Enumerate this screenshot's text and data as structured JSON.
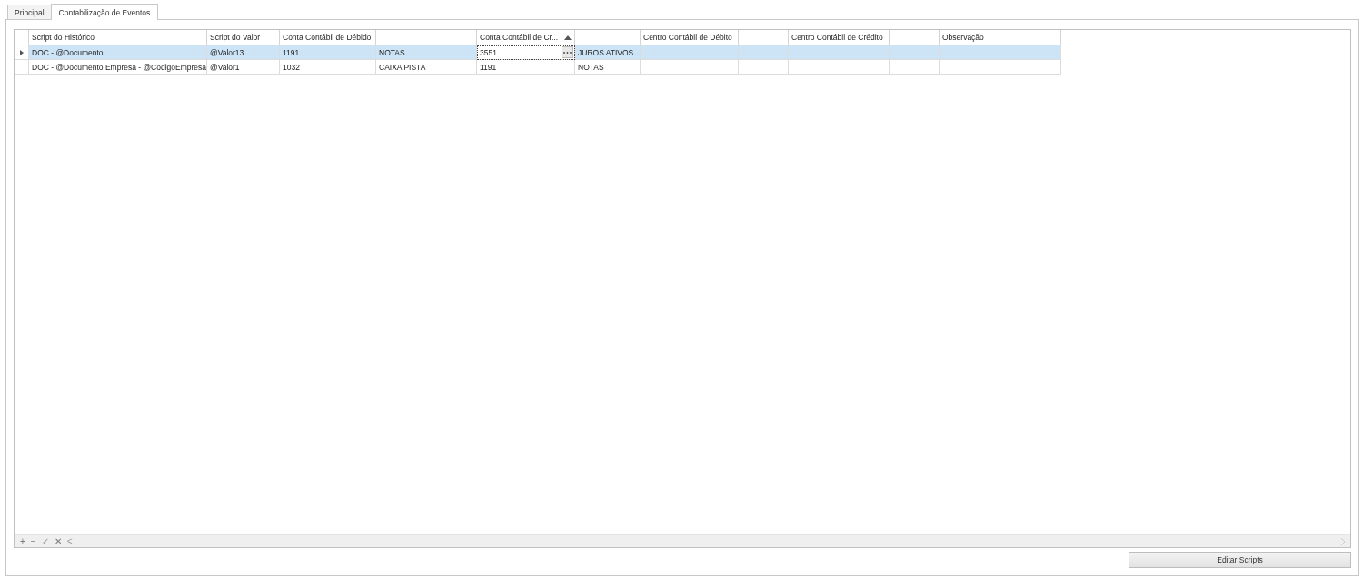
{
  "tabs": [
    {
      "label": "Principal",
      "selected": false
    },
    {
      "label": "Contabilização de Eventos",
      "selected": true
    }
  ],
  "grid": {
    "columns": [
      {
        "label": "Script do Histórico",
        "sorted_ascending": false
      },
      {
        "label": "Script do Valor",
        "sorted_ascending": false
      },
      {
        "label": "Conta Contábil de Débido",
        "sorted_ascending": false
      },
      {
        "sorted_ascending": false
      },
      {
        "label": "Conta Contábil de Cr...",
        "sorted_ascending": true
      },
      {
        "sorted_ascending": false
      },
      {
        "label": "Centro Contábil de Débito",
        "sorted_ascending": false
      },
      {
        "sorted_ascending": false
      },
      {
        "label": "Centro Contábil de Crédito",
        "sorted_ascending": false
      },
      {
        "sorted_ascending": false
      },
      {
        "label": "Observação",
        "sorted_ascending": false
      }
    ],
    "rows": [
      {
        "selected": true,
        "cells": [
          {
            "text": "DOC - @Documento",
            "focused": false
          },
          {
            "text": "@Valor13",
            "focused": false
          },
          {
            "text": "1191",
            "focused": false
          },
          {
            "text": "NOTAS",
            "focused": false
          },
          {
            "text": "3551",
            "focused": true
          },
          {
            "text": "JUROS ATIVOS",
            "focused": false
          },
          {
            "focused": false
          },
          {
            "focused": false
          },
          {
            "focused": false
          },
          {
            "focused": false
          },
          {
            "focused": false
          }
        ]
      },
      {
        "selected": false,
        "cells": [
          {
            "text": "DOC - @Documento Empresa - @CodigoEmpresa",
            "focused": false
          },
          {
            "text": "@Valor1",
            "focused": false
          },
          {
            "text": "1032",
            "focused": false
          },
          {
            "text": "CAIXA PISTA",
            "focused": false
          },
          {
            "text": "1191",
            "focused": false
          },
          {
            "text": "NOTAS",
            "focused": false
          },
          {
            "focused": false
          },
          {
            "focused": false
          },
          {
            "focused": false
          },
          {
            "focused": false
          },
          {
            "focused": false
          }
        ]
      }
    ],
    "navigator": [
      {
        "label": "+",
        "disabled": false
      },
      {
        "label": "−",
        "disabled": false
      },
      {
        "label": "✓",
        "disabled": true
      },
      {
        "label": "✕",
        "disabled": false
      },
      {
        "label": "<",
        "disabled": true
      }
    ]
  },
  "button": {
    "label": "Editar Scripts"
  }
}
